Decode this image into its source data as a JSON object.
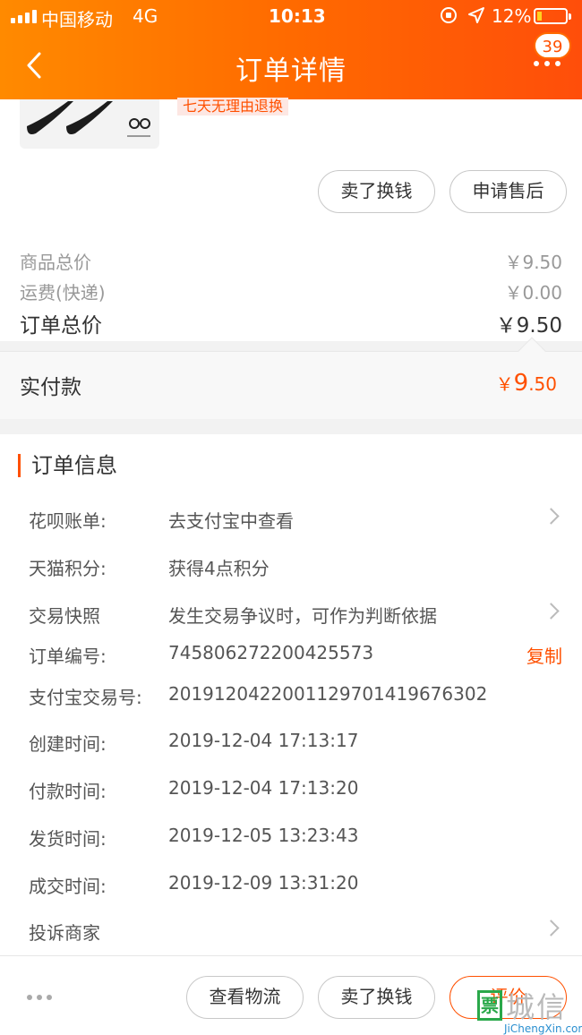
{
  "status_bar": {
    "carrier": "中国移动",
    "network": "4G",
    "time": "10:13",
    "battery": "12%"
  },
  "header": {
    "title": "订单详情",
    "badge_count": "39"
  },
  "product": {
    "tag": "七天无理由退换"
  },
  "product_actions": {
    "sell_label": "卖了换钱",
    "after_sale_label": "申请售后"
  },
  "price_summary": {
    "goods_total_label": "商品总价",
    "goods_total_value": "￥9.50",
    "shipping_label": "运费(快递)",
    "shipping_value": "￥0.00",
    "order_total_label": "订单总价",
    "order_total_value": "￥9.50"
  },
  "payment": {
    "label": "实付款",
    "currency": "￥",
    "integer": "9",
    "decimal": ".50"
  },
  "order_info": {
    "section_title": "订单信息",
    "rows": [
      {
        "label": "花呗账单:",
        "value": "去支付宝中查看"
      },
      {
        "label": "天猫积分:",
        "value": "获得4点积分"
      },
      {
        "label": "交易快照",
        "value": "发生交易争议时，可作为判断依据"
      },
      {
        "label": "订单编号:",
        "value": "745806272200425573",
        "action": "复制"
      },
      {
        "label": "支付宝交易号:",
        "value": "2019120422001129701419676302"
      },
      {
        "label": "创建时间:",
        "value": "2019-12-04 17:13:17"
      },
      {
        "label": "付款时间:",
        "value": "2019-12-04 17:13:20"
      },
      {
        "label": "发货时间:",
        "value": "2019-12-05 13:23:43"
      },
      {
        "label": "成交时间:",
        "value": "2019-12-09 13:31:20"
      },
      {
        "label": "投诉商家",
        "value": ""
      }
    ]
  },
  "bottom_bar": {
    "logistics_label": "查看物流",
    "sell_label": "卖了换钱",
    "review_label": "评价"
  },
  "watermark": {
    "badge": "票",
    "text_cn": "城信",
    "text_en": "JiChengXin.com"
  },
  "colors": {
    "accent": "#ff5000",
    "header_start": "#ff8a00",
    "header_end": "#ff4e0a"
  }
}
